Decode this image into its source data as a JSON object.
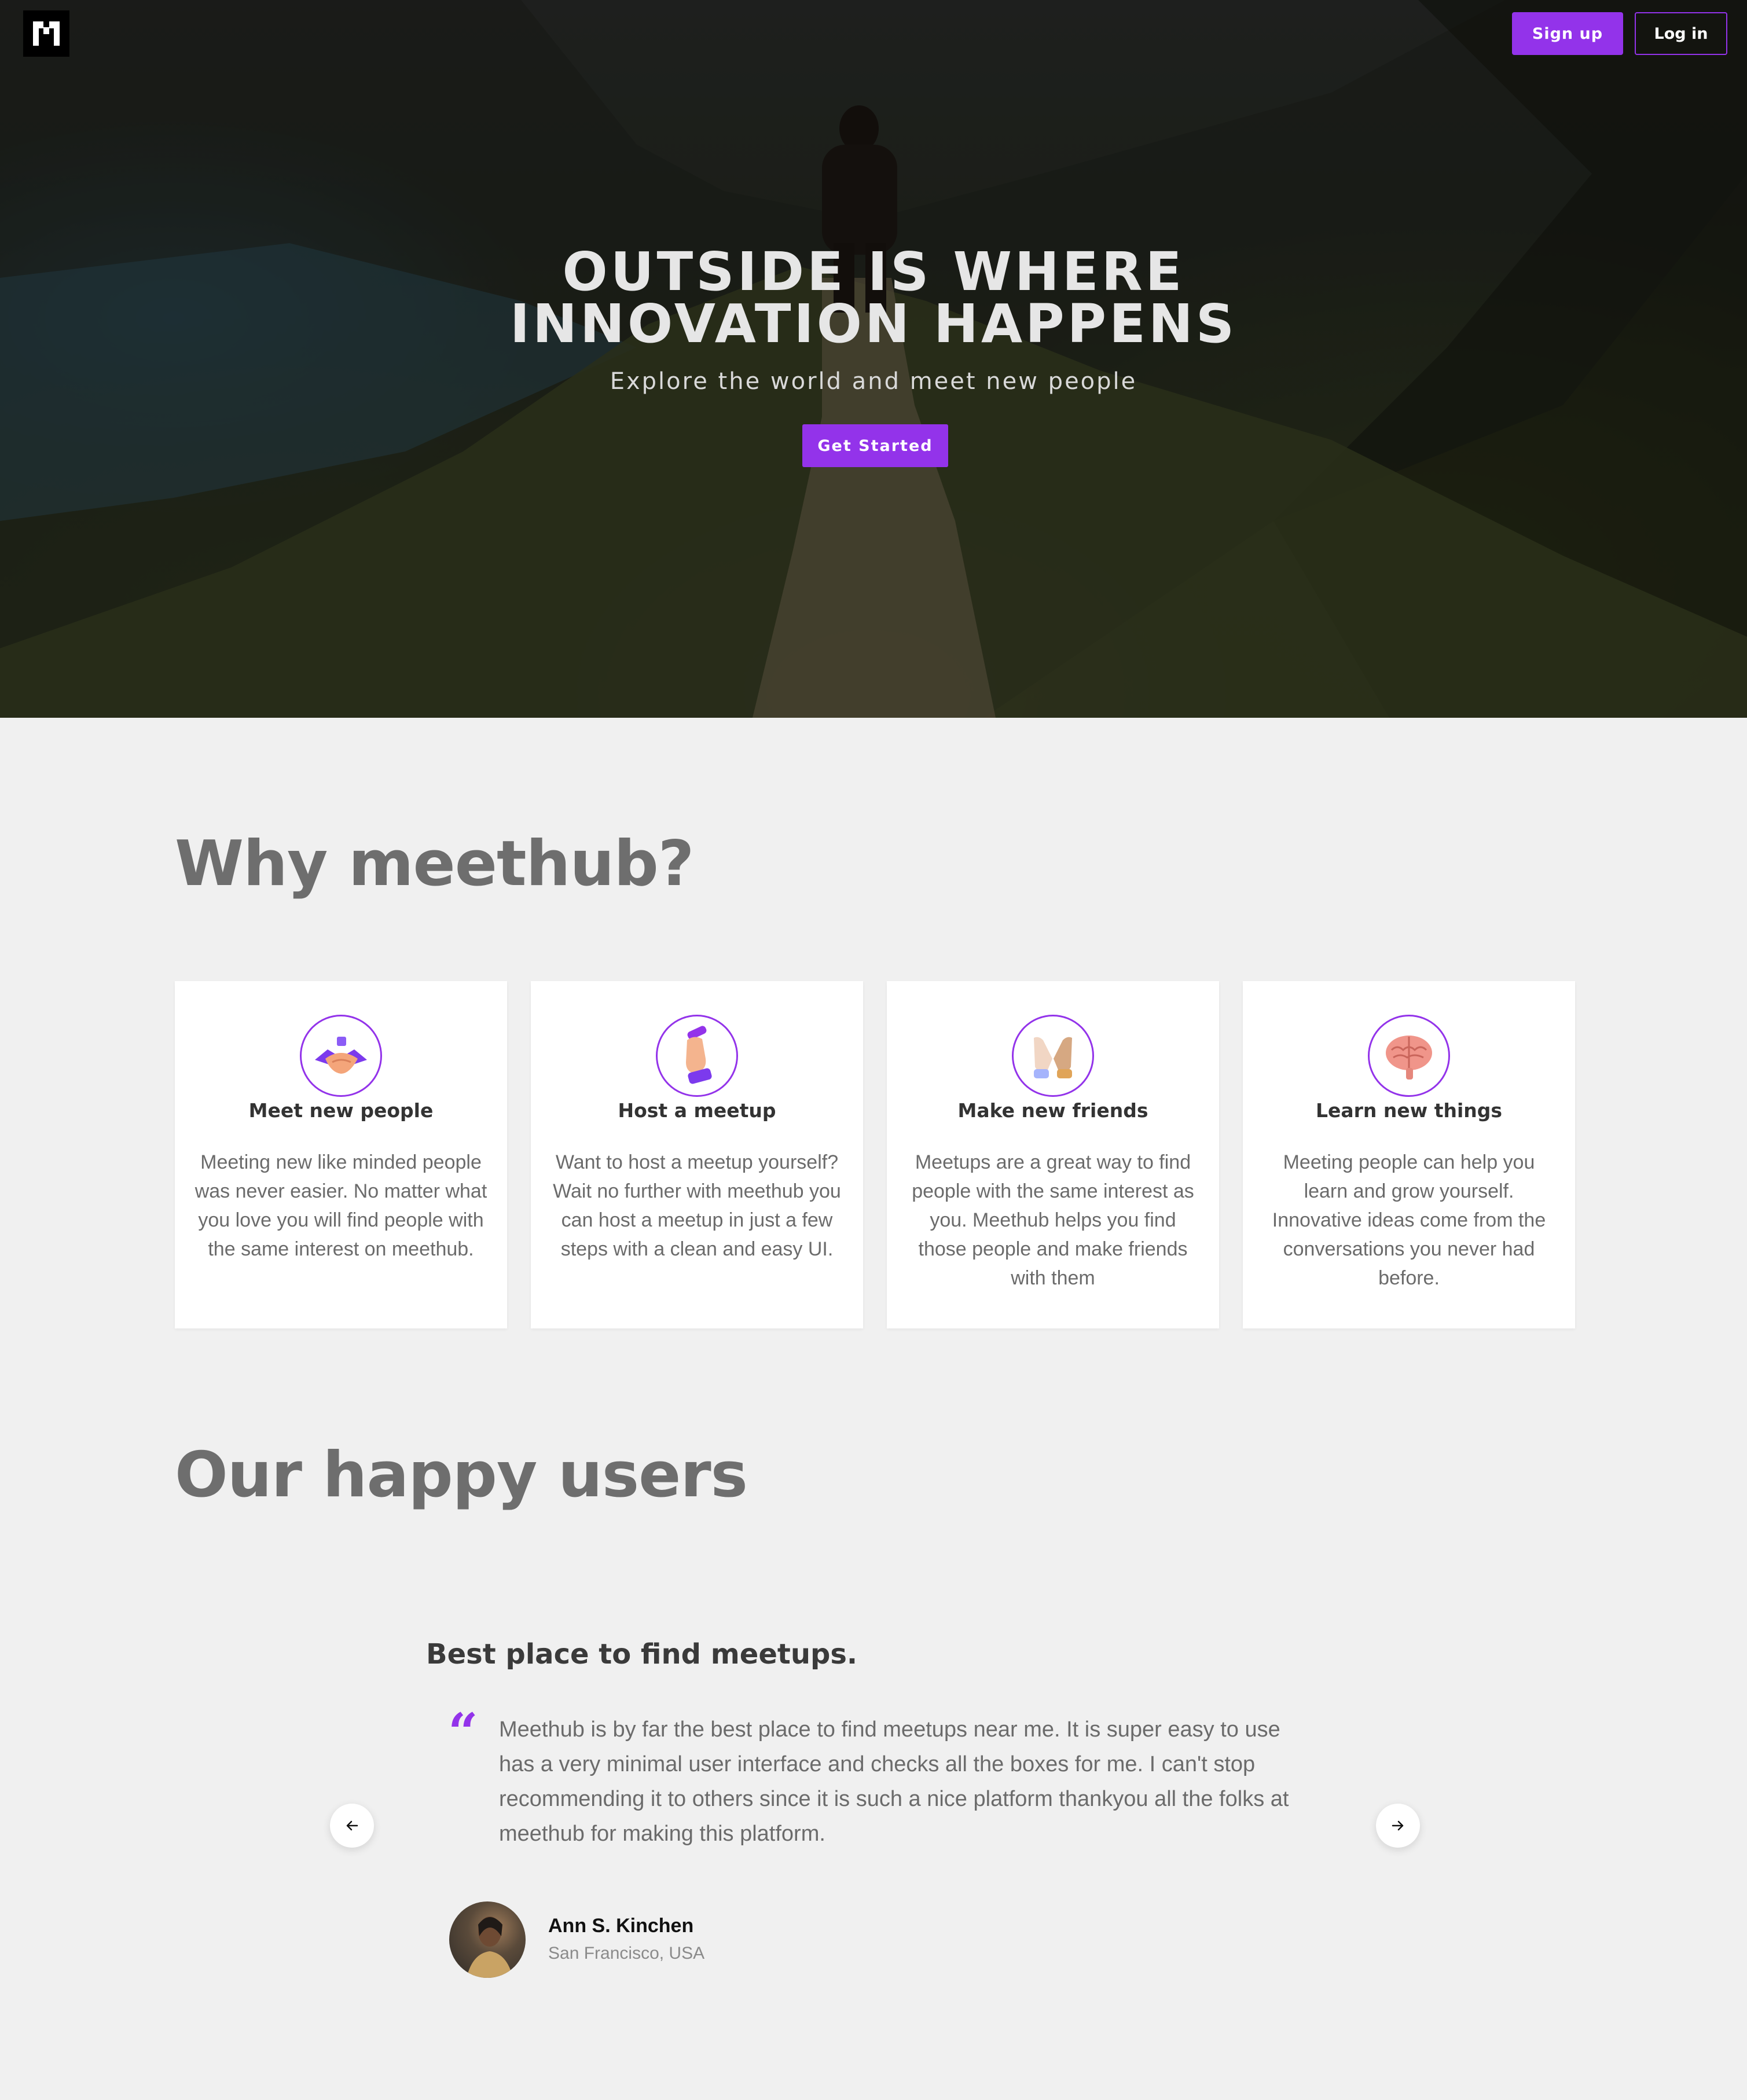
{
  "brand": {
    "logo_icon": "meethub-logo-icon"
  },
  "nav": {
    "signup_label": "Sign up",
    "login_label": "Log in"
  },
  "hero": {
    "title_line1": "OUTSIDE IS WHERE",
    "title_line2": "INNOVATION HAPPENS",
    "subtitle": "Explore the world and meet new people",
    "cta_label": "Get Started"
  },
  "why": {
    "title": "Why meethub?",
    "cards": [
      {
        "icon": "handshake-icon",
        "title": "Meet new people",
        "description": "Meeting new like minded people was never easier. No matter what you love you will find people with the same interest on meethub."
      },
      {
        "icon": "writing-hand-icon",
        "title": "Host a meetup",
        "description": "Want to host a meetup yourself? Wait no further with meethub you can host a meetup in just a few steps with a clean and easy UI."
      },
      {
        "icon": "high-five-icon",
        "title": "Make new friends",
        "description": "Meetups are a great way to find people with the same interest as you. Meethub helps you find those people and make friends with them"
      },
      {
        "icon": "brain-icon",
        "title": "Learn new things",
        "description": "Meeting people can help you learn and grow yourself. Innovative ideas come from the conversations you never had before."
      }
    ]
  },
  "testimonials": {
    "title": "Our happy users",
    "current": {
      "heading": "Best place to find meetups.",
      "quote": "Meethub is by far the best place to find meetups near me. It is super easy to use has a very minimal user interface and checks all the boxes for me. I can't stop recommending it to others since it is such a nice platform thankyou all the folks at meethub for making this platform.",
      "name": "Ann S. Kinchen",
      "location": "San Francisco, USA"
    },
    "prev_icon": "arrow-left-icon",
    "next_icon": "arrow-right-icon"
  },
  "colors": {
    "accent": "#9333ea",
    "background": "#f0f0f0",
    "heading_gray": "#6e6e6e"
  }
}
